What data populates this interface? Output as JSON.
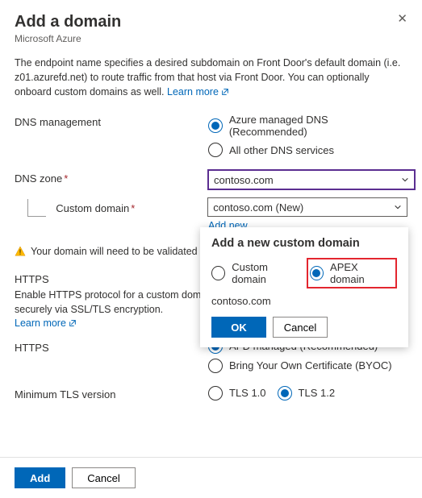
{
  "header": {
    "title": "Add a domain",
    "subtitle": "Microsoft Azure"
  },
  "description": {
    "text": "The endpoint name specifies a desired subdomain on Front Door's default domain (i.e. z01.azurefd.net) to route traffic from that host via Front Door. You can optionally onboard custom domains as well.",
    "learn_more": "Learn more"
  },
  "dns_mgmt": {
    "label": "DNS management",
    "opt1": "Azure managed DNS (Recommended)",
    "opt2": "All other DNS services"
  },
  "dns_zone": {
    "label": "DNS zone",
    "value": "contoso.com"
  },
  "custom_domain": {
    "label": "Custom domain",
    "value": "contoso.com (New)",
    "add_new": "Add new"
  },
  "warning": "Your domain will need to be validated before it can be used.",
  "https_section": {
    "title": "HTTPS",
    "desc": "Enable HTTPS protocol for a custom domain to ensure your sensitive data is delivered securely via SSL/TLS encryption.",
    "learn_more": "Learn more"
  },
  "https": {
    "label": "HTTPS",
    "opt1": "AFD managed (Recommended)",
    "opt2": "Bring Your Own Certificate (BYOC)"
  },
  "tls": {
    "label": "Minimum TLS version",
    "opt1": "TLS 1.0",
    "opt2": "TLS 1.2"
  },
  "footer": {
    "add": "Add",
    "cancel": "Cancel"
  },
  "popup": {
    "title": "Add a new custom domain",
    "opt_custom": "Custom domain",
    "opt_apex": "APEX domain",
    "domain": "contoso.com",
    "ok": "OK",
    "cancel": "Cancel"
  }
}
